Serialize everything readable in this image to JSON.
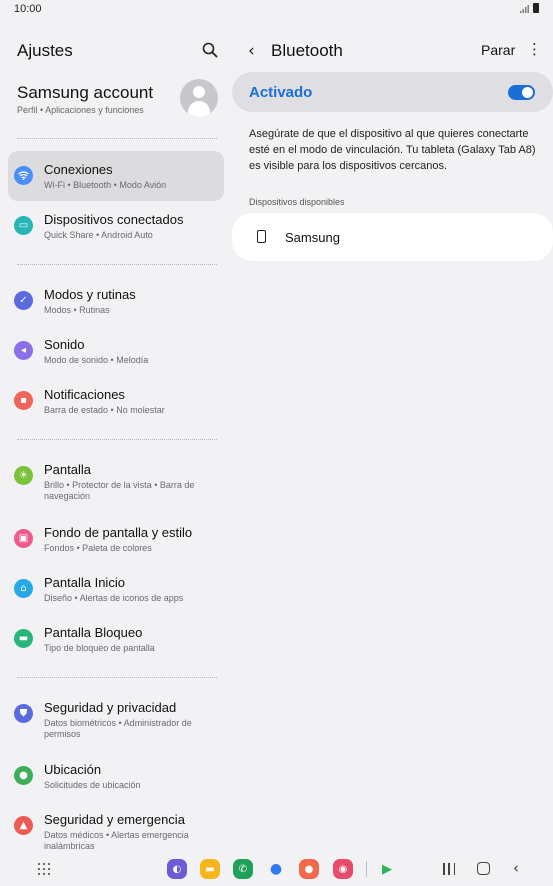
{
  "status_bar": {
    "time": "10:00"
  },
  "left_pane": {
    "title": "Ajustes",
    "account": {
      "name": "Samsung account",
      "subtitle": "Perfil • Aplicaciones y funciones"
    },
    "items": [
      {
        "id": "conexiones",
        "title": "Conexiones",
        "subtitle": "Wi-Fi • Bluetooth • Modo Avión",
        "icon": "wifi-icon",
        "color": "#4a8ff7",
        "active": true
      },
      {
        "id": "dispositivos",
        "title": "Dispositivos conectados",
        "subtitle": "Quick Share • Android Auto",
        "icon": "devices-icon",
        "color": "#27b5b5"
      },
      {
        "id": "modos",
        "title": "Modos y rutinas",
        "subtitle": "Modos • Rutinas",
        "icon": "check-circle-icon",
        "color": "#5a6be0"
      },
      {
        "id": "sonido",
        "title": "Sonido",
        "subtitle": "Modo de sonido • Melodía",
        "icon": "speaker-icon",
        "color": "#8b6fe8"
      },
      {
        "id": "notificaciones",
        "title": "Notificaciones",
        "subtitle": "Barra de estado • No molestar",
        "icon": "bell-icon",
        "color": "#f0655a"
      },
      {
        "id": "pantalla",
        "title": "Pantalla",
        "subtitle": "Brillo • Protector de la vista • Barra de navegación",
        "icon": "sun-icon",
        "color": "#7bc23b"
      },
      {
        "id": "fondo",
        "title": "Fondo de pantalla y estilo",
        "subtitle": "Fondos • Paleta de colores",
        "icon": "picture-icon",
        "color": "#ef5b8e"
      },
      {
        "id": "inicio",
        "title": "Pantalla Inicio",
        "subtitle": "Diseño • Alertas de iconos de apps",
        "icon": "home-icon",
        "color": "#26a9e6"
      },
      {
        "id": "bloqueo",
        "title": "Pantalla Bloqueo",
        "subtitle": "Tipo de bloqueo de pantalla",
        "icon": "lock-icon",
        "color": "#27b57a"
      },
      {
        "id": "seguridad",
        "title": "Seguridad y privacidad",
        "subtitle": "Datos biométricos • Administrador de permisos",
        "icon": "shield-icon",
        "color": "#5a6be0"
      },
      {
        "id": "ubicacion",
        "title": "Ubicación",
        "subtitle": "Solicitudes de ubicación",
        "icon": "location-pin-icon",
        "color": "#3fae5a"
      },
      {
        "id": "emergencia",
        "title": "Seguridad y emergencia",
        "subtitle": "Datos médicos • Alertas emergencia inalámbricas",
        "icon": "emergency-icon",
        "color": "#ee5b55"
      }
    ]
  },
  "right_pane": {
    "title": "Bluetooth",
    "stop_label": "Parar",
    "toggle_label": "Activado",
    "toggle_on": true,
    "description": "Asegúrate de que el dispositivo al que quieres conectarte esté en el modo de vinculación. Tu tableta (Galaxy Tab A8) es visible para los dispositivos cercanos.",
    "section_label": "Dispositivos disponibles",
    "devices": [
      {
        "name": "Samsung",
        "icon": "phone-icon"
      }
    ],
    "accent": "#1a6fd6"
  },
  "nav_bar": {
    "dock": [
      {
        "name": "internet-app-icon",
        "color": "#6b5bd6",
        "glyph": "◐"
      },
      {
        "name": "files-app-icon",
        "color": "#f6b51c",
        "glyph": "▬"
      },
      {
        "name": "phone-app-icon",
        "color": "#1fa15a",
        "glyph": "✆"
      },
      {
        "name": "messages-app-icon",
        "color": "#2f7bf0",
        "glyph": "●"
      },
      {
        "name": "contacts-app-icon",
        "color": "#f26a4b",
        "glyph": "●"
      },
      {
        "name": "camera-app-icon",
        "color": "#e84a6c",
        "glyph": "◉"
      },
      {
        "name": "play-store-app-icon",
        "color": "#ffffff",
        "glyph": "▶"
      }
    ]
  }
}
